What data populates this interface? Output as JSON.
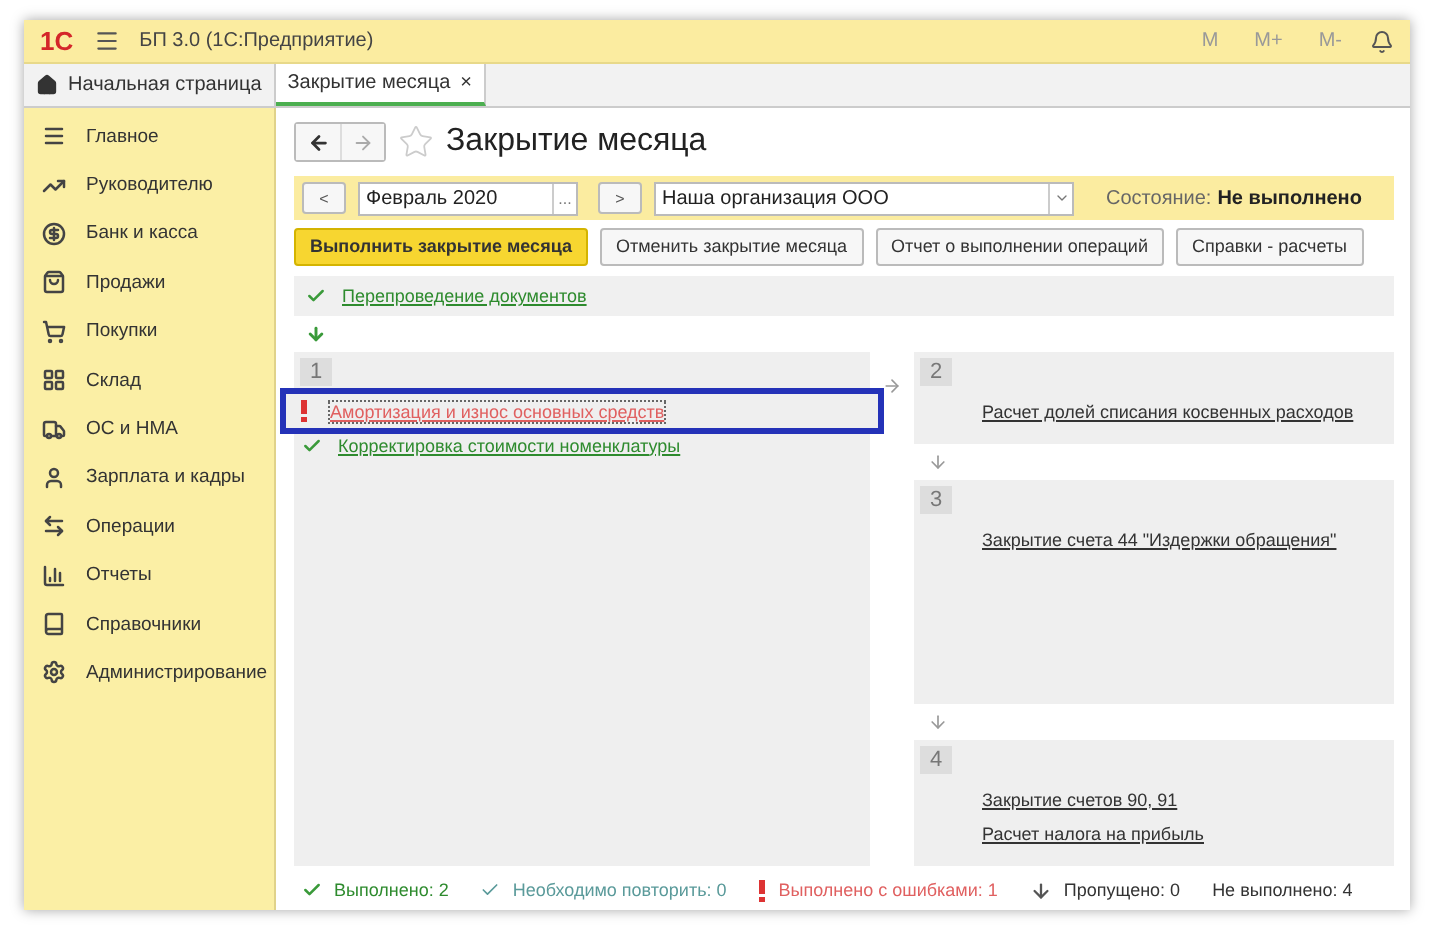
{
  "window": {
    "logo": "1С",
    "title": "БП 3.0  (1С:Предприятие)",
    "tools": [
      "M",
      "M+",
      "M-"
    ]
  },
  "tabs": [
    {
      "label": "Начальная страница",
      "selected": false,
      "kind": "home"
    },
    {
      "label": "Закрытие месяца",
      "selected": true,
      "close": "×"
    }
  ],
  "sidebar": {
    "items": [
      {
        "label": "Главное"
      },
      {
        "label": "Руководителю"
      },
      {
        "label": "Банк и касса"
      },
      {
        "label": "Продажи"
      },
      {
        "label": "Покупки"
      },
      {
        "label": "Склад"
      },
      {
        "label": "ОС и НМА"
      },
      {
        "label": "Зарплата и кадры"
      },
      {
        "label": "Операции"
      },
      {
        "label": "Отчеты"
      },
      {
        "label": "Справочники"
      },
      {
        "label": "Администрирование"
      }
    ]
  },
  "page": {
    "title": "Закрытие месяца",
    "filter": {
      "prev": "<",
      "period": "Февраль 2020",
      "period_button": "...",
      "next": ">",
      "organization": "Наша организация ООО",
      "state_label": "Состояние:",
      "state": "Не выполнено"
    },
    "buttons": [
      {
        "label": "Выполнить закрытие месяца",
        "kind": "primary"
      },
      {
        "label": "Отменить закрытие месяца",
        "kind": "normal"
      },
      {
        "label": "Отчет о выполнении операций",
        "kind": "normal"
      },
      {
        "label": "Справки - расчеты",
        "kind": "normal"
      }
    ],
    "pre": {
      "text": "Перепроведение документов",
      "kind": "done"
    },
    "stages": [
      {
        "number": "1",
        "items": [
          {
            "text": "Амортизация и износ основных средств",
            "kind": "error",
            "selected": true
          },
          {
            "text": "Корректировка стоимости номенклатуры",
            "kind": "done",
            "selected": false
          }
        ]
      },
      {
        "number": "2",
        "items": [
          {
            "text": "Расчет долей списания косвенных расходов",
            "kind": "none",
            "selected": false
          }
        ]
      },
      {
        "number": "3",
        "items": [
          {
            "text": "Закрытие счета 44 \"Издержки обращения\"",
            "kind": "none",
            "selected": false
          }
        ]
      },
      {
        "number": "4",
        "items": [
          {
            "text": "Закрытие счетов 90, 91",
            "kind": "none",
            "selected": false
          },
          {
            "text": "Расчет налога на прибыль",
            "kind": "none",
            "selected": false
          }
        ]
      }
    ],
    "status_bar": [
      {
        "kind": "done",
        "text": "Выполнено: 2"
      },
      {
        "kind": "repeat",
        "text": "Необходимо повторить: 0"
      },
      {
        "kind": "error",
        "text": "Выполнено с ошибками: 1"
      },
      {
        "kind": "skipped",
        "text": "Пропущено: 0"
      },
      {
        "kind": "notdone",
        "text": "Не выполнено: 4"
      }
    ]
  }
}
